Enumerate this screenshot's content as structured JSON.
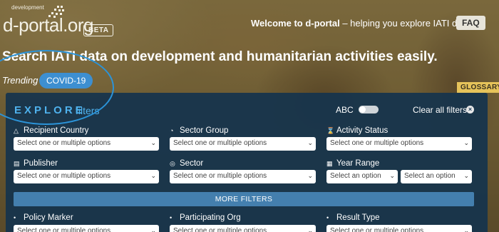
{
  "header": {
    "logo_small": "development",
    "logo_main": "d-portal.org",
    "beta": "BETA",
    "welcome_bold": "Welcome to d-portal",
    "welcome_rest": " – helping you explore IATI data",
    "faq": "FAQ"
  },
  "hero": {
    "headline": "Search IATI data on development and humanitarian activities easily.",
    "trending_label": "Trending",
    "trending_tag": "COVID-19",
    "glossary": "GLOSSARY"
  },
  "filters": {
    "title": "EXPLORE",
    "subtitle": "filters",
    "abc_label": "ABC",
    "clear_all": "Clear all filters",
    "clear_icon": "×",
    "placeholder": "Select one or multiple options",
    "option_placeholder": "Select an option",
    "recipient_country": "Recipient Country",
    "sector_group": "Sector Group",
    "activity_status": "Activity Status",
    "publisher": "Publisher",
    "sector": "Sector",
    "year_range": "Year Range",
    "more_filters": "MORE FILTERS",
    "policy_marker": "Policy Marker",
    "participating_org": "Participating Org",
    "result_type": "Result Type"
  },
  "colors": {
    "panel": "#16344c",
    "accent_blue": "#4fb2ee",
    "pill_blue": "#3d8fd1",
    "glossary_gold": "#e6c35a",
    "highlight_oval": "#2b93d8"
  },
  "icons": {
    "recipient_country": "triangle-icon",
    "sector_group": "pie-icon",
    "activity_status": "hourglass-icon",
    "publisher": "document-icon",
    "sector": "target-icon",
    "year_range": "calendar-icon",
    "policy_marker": "dot-icon",
    "participating_org": "dot-icon",
    "result_type": "dot-icon"
  }
}
